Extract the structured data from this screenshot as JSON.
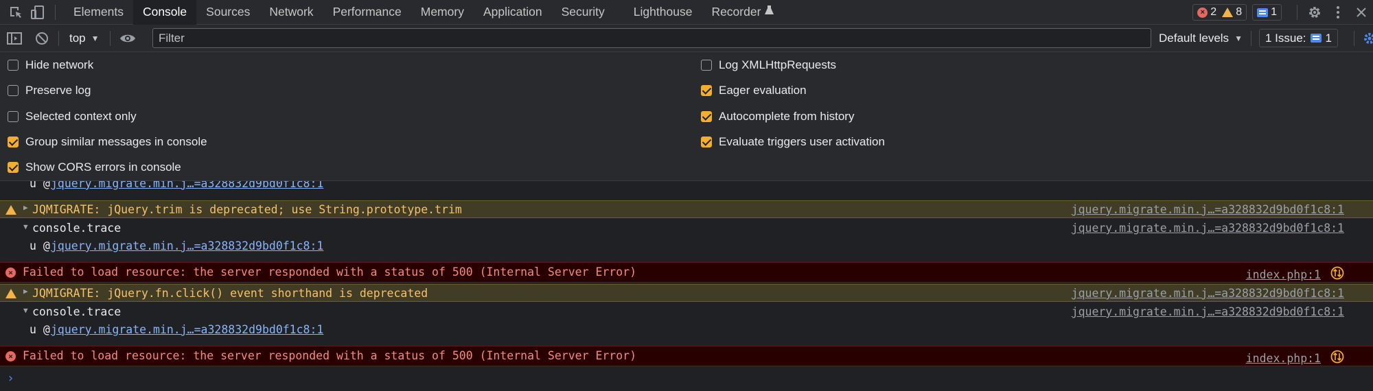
{
  "tabs": [
    "Elements",
    "Console",
    "Sources",
    "Network",
    "Performance",
    "Memory",
    "Application",
    "Security",
    "Lighthouse",
    "Recorder"
  ],
  "active_tab": "Console",
  "counts": {
    "errors": "2",
    "warnings": "8",
    "messages": "1"
  },
  "toolbar": {
    "context": "top",
    "filter_placeholder": "Filter",
    "levels": "Default levels",
    "issues_label": "1 Issue:",
    "issues_count": "1"
  },
  "settings": {
    "left": [
      {
        "label": "Hide network",
        "checked": false
      },
      {
        "label": "Preserve log",
        "checked": false
      },
      {
        "label": "Selected context only",
        "checked": false
      },
      {
        "label": "Group similar messages in console",
        "checked": true
      },
      {
        "label": "Show CORS errors in console",
        "checked": true
      }
    ],
    "right": [
      {
        "label": "Log XMLHttpRequests",
        "checked": false
      },
      {
        "label": "Eager evaluation",
        "checked": true
      },
      {
        "label": "Autocomplete from history",
        "checked": true
      },
      {
        "label": "Evaluate triggers user activation",
        "checked": true
      }
    ]
  },
  "console": {
    "trace_prefix": "u @",
    "trace_link": "jquery.migrate.min.j…=a328832d9bd0f1c8:1",
    "source_link": "jquery.migrate.min.j…=a328832d9bd0f1c8:1",
    "warn1": "JQMIGRATE: jQuery.trim is deprecated; use String.prototype.trim",
    "trace_label": "console.trace",
    "error_text": "Failed to load resource: the server responded with a status of 500 (Internal Server Error)",
    "error_source": "index.php:1",
    "warn2": "JQMIGRATE: jQuery.fn.click() event shorthand is deprecated"
  },
  "colors": {
    "warn": "#f5c16c",
    "error": "#f28b82",
    "accent": "#f3ad2f",
    "link": "#8ab4f8"
  }
}
